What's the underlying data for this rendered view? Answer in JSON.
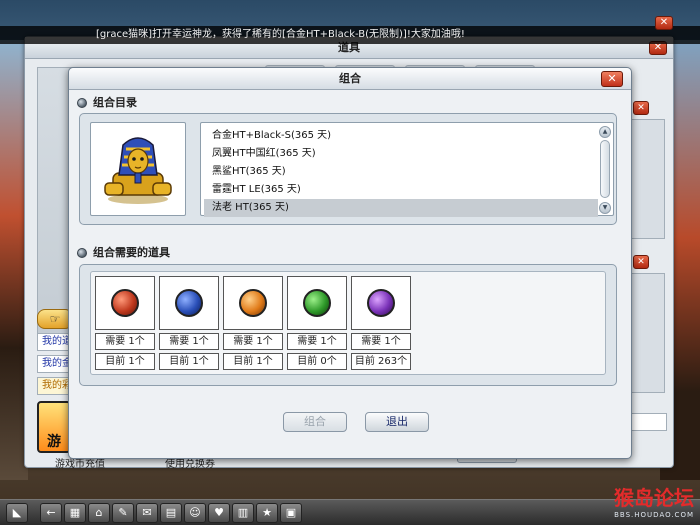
{
  "broadcast": {
    "message": "[grace猫咪]打开幸运神龙，获得了稀有的[合金HT+Black-B(无限制)]!大家加油哦!"
  },
  "background_window": {
    "title": "道具",
    "links": [
      "我的道",
      "我的金",
      "我的彩"
    ],
    "game_tile_label": "游",
    "footer_left": "游戏币充值",
    "footer_right": "使用兑换券"
  },
  "dialog": {
    "title": "组合",
    "close_label": "✕",
    "catalog": {
      "heading": "组合目录",
      "items": [
        "合金HT+Black-S(365 天)",
        "凤翼HT中国红(365 天)",
        "黑鲨HT(365 天)",
        "雷霆HT LE(365 天)",
        "法老 HT(365 天)"
      ],
      "selected_index": 4,
      "thumbnail_icon": "pharaoh-sphinx-icon"
    },
    "required": {
      "heading": "组合需要的道具",
      "slots": [
        {
          "gem_icon": "red-gem-icon",
          "gem_color": "#c0391e",
          "need": "需要 1个",
          "have": "目前 1个"
        },
        {
          "gem_icon": "blue-gem-icon",
          "gem_color": "#2a4fb8",
          "need": "需要 1个",
          "have": "目前 1个"
        },
        {
          "gem_icon": "orange-gem-icon",
          "gem_color": "#e07a18",
          "need": "需要 1个",
          "have": "目前 1个"
        },
        {
          "gem_icon": "green-gem-icon",
          "gem_color": "#2f9a2a",
          "need": "需要 1个",
          "have": "目前 0个"
        },
        {
          "gem_icon": "purple-gem-icon",
          "gem_color": "#7a32b8",
          "need": "需要 1个",
          "have": "目前 263个"
        }
      ]
    },
    "buttons": {
      "combine": "组合",
      "exit": "退出"
    }
  },
  "watermark": {
    "title": "猴岛论坛",
    "subtitle": "BBS.HOUDAO.COM"
  }
}
